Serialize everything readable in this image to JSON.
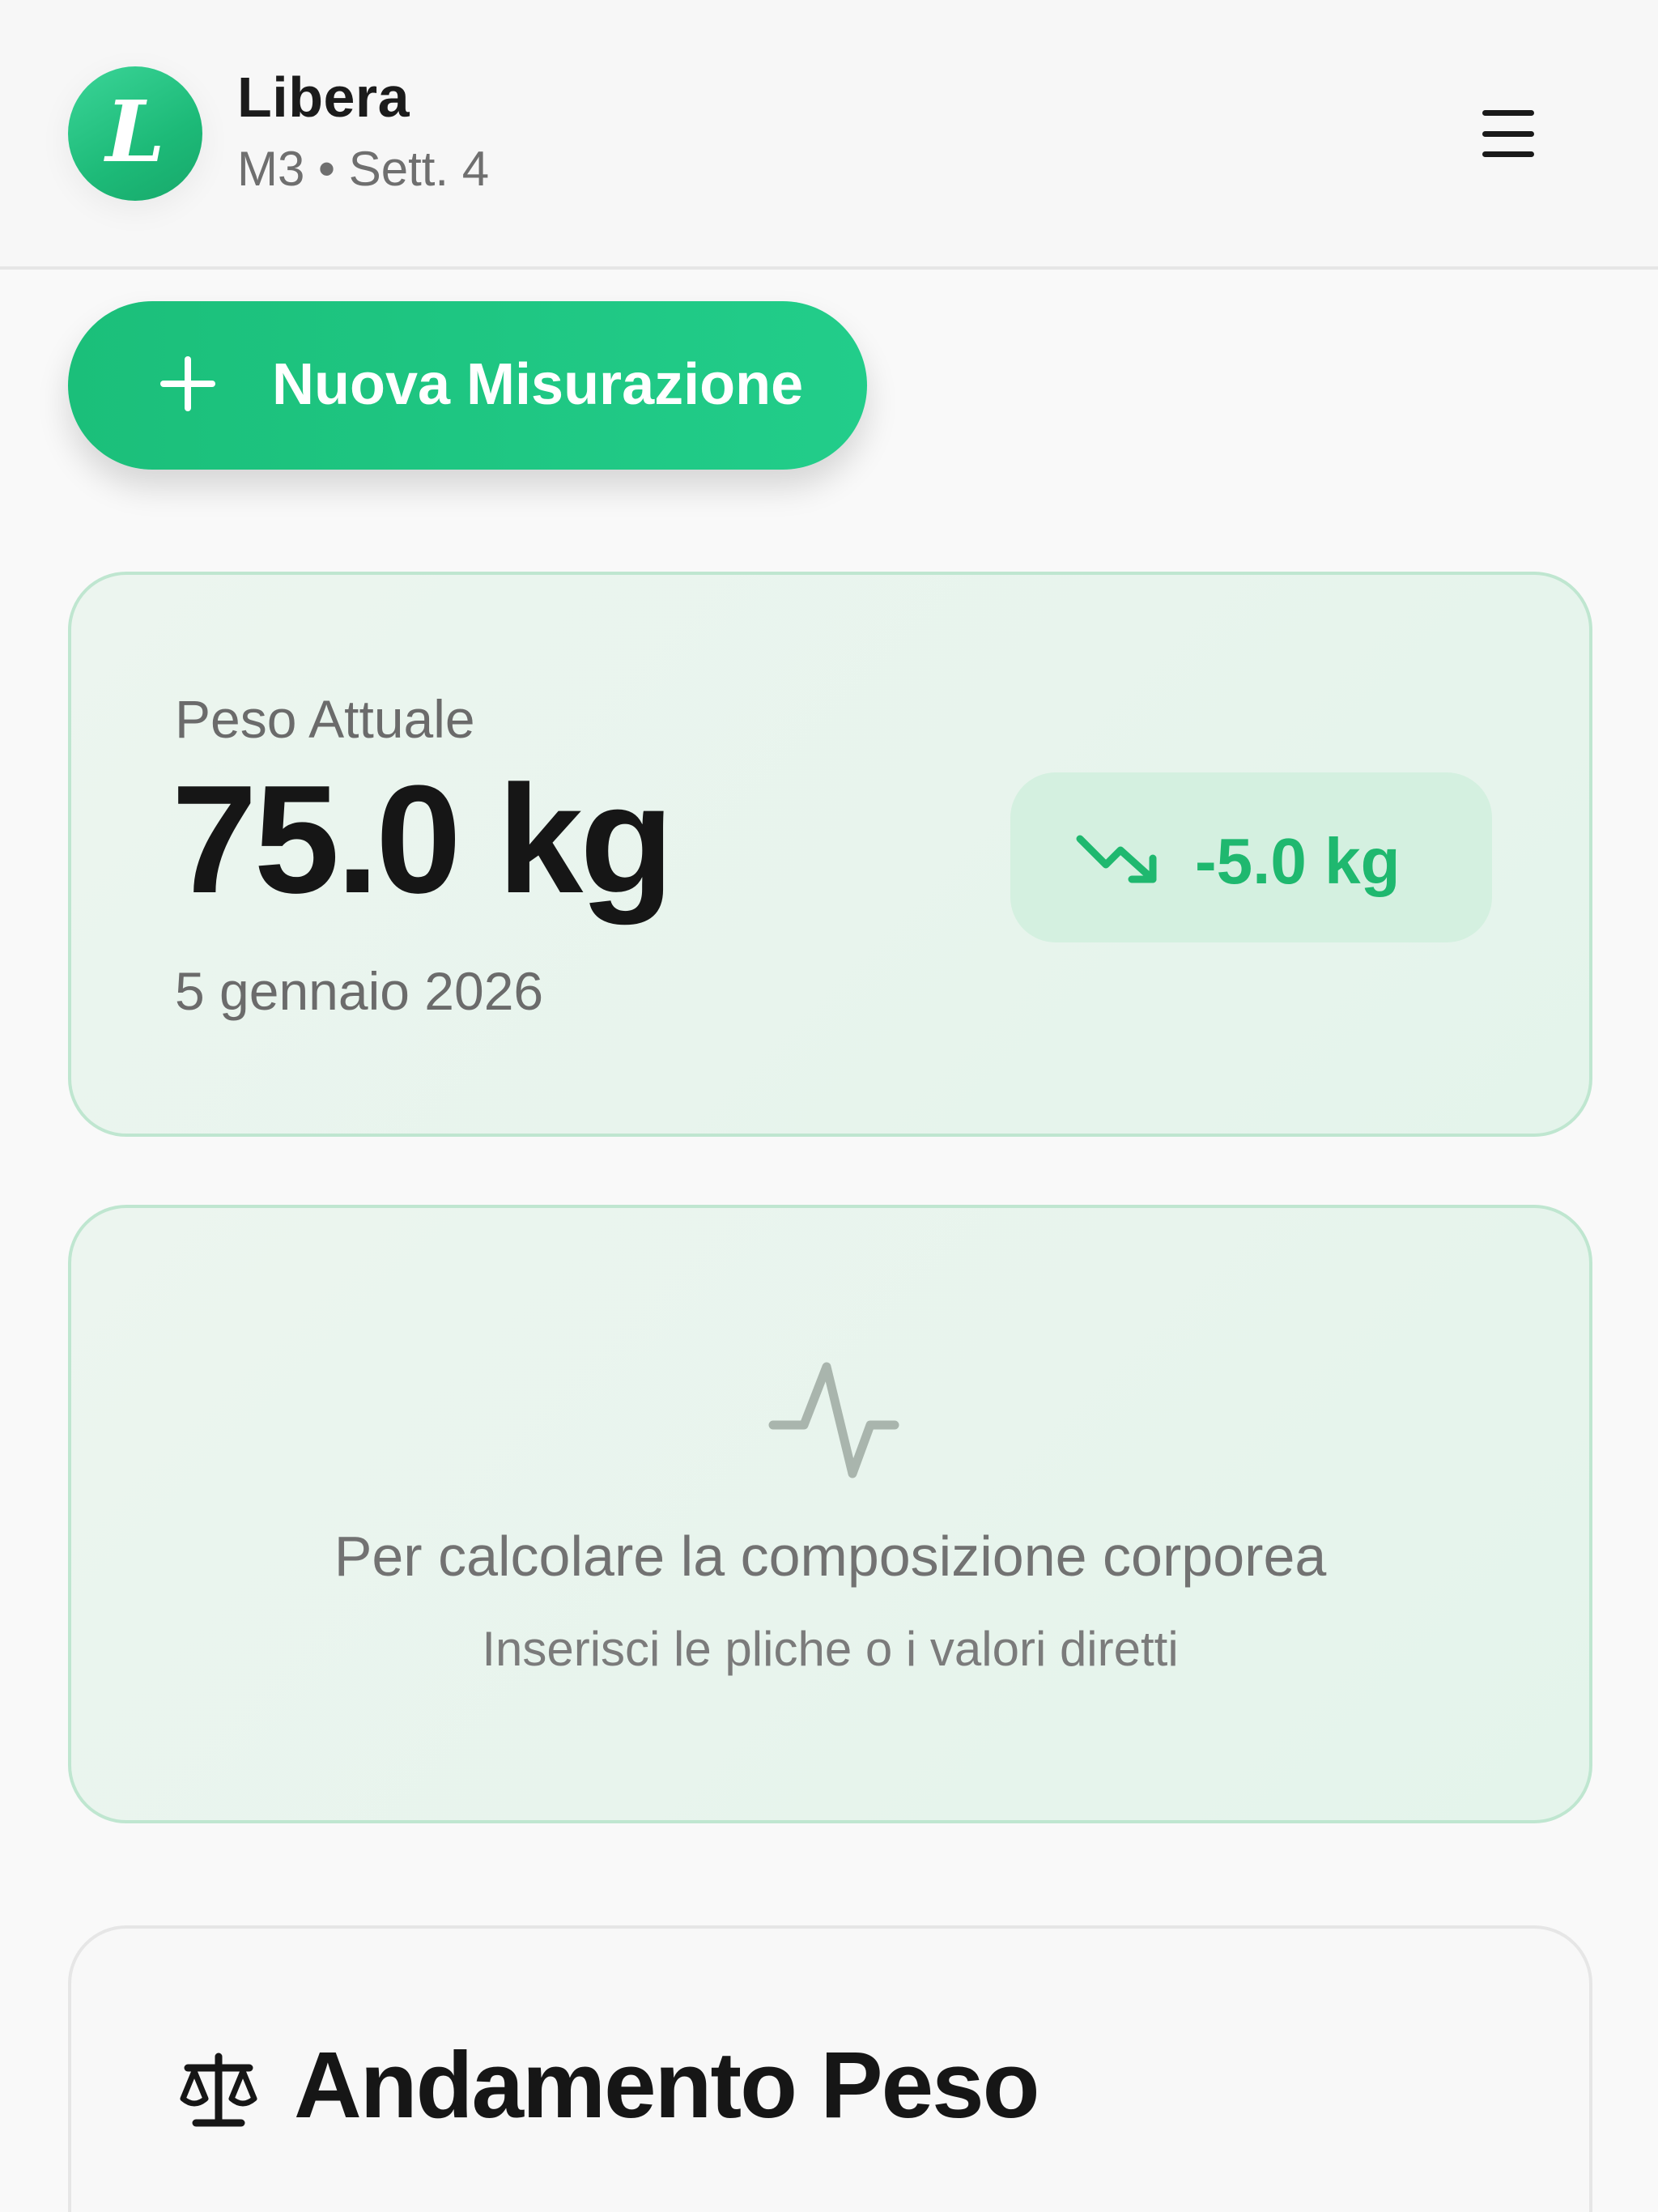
{
  "header": {
    "logo_letter": "L",
    "title": "Libera",
    "subtitle": "M3 • Sett. 4",
    "menu_icon": "hamburger-menu-icon"
  },
  "actions": {
    "new_measurement_label": "Nuova Misurazione",
    "new_measurement_icon": "plus-icon"
  },
  "weight_card": {
    "label": "Peso Attuale",
    "value": "75.0 kg",
    "date": "5 gennaio 2026",
    "delta": "-5.0 kg",
    "delta_icon": "trending-down-icon",
    "delta_color": "#1fb86f"
  },
  "body_composition_card": {
    "icon": "activity-pulse-icon",
    "message": "Per calcolare la composizione corporea",
    "hint": "Inserisci le pliche o i valori diretti"
  },
  "trend_card": {
    "icon": "scale-icon",
    "title": "Andamento Peso"
  },
  "colors": {
    "accent": "#1dba78",
    "card_border": "#bfe6d0",
    "card_bg": "#e8f5ed"
  }
}
